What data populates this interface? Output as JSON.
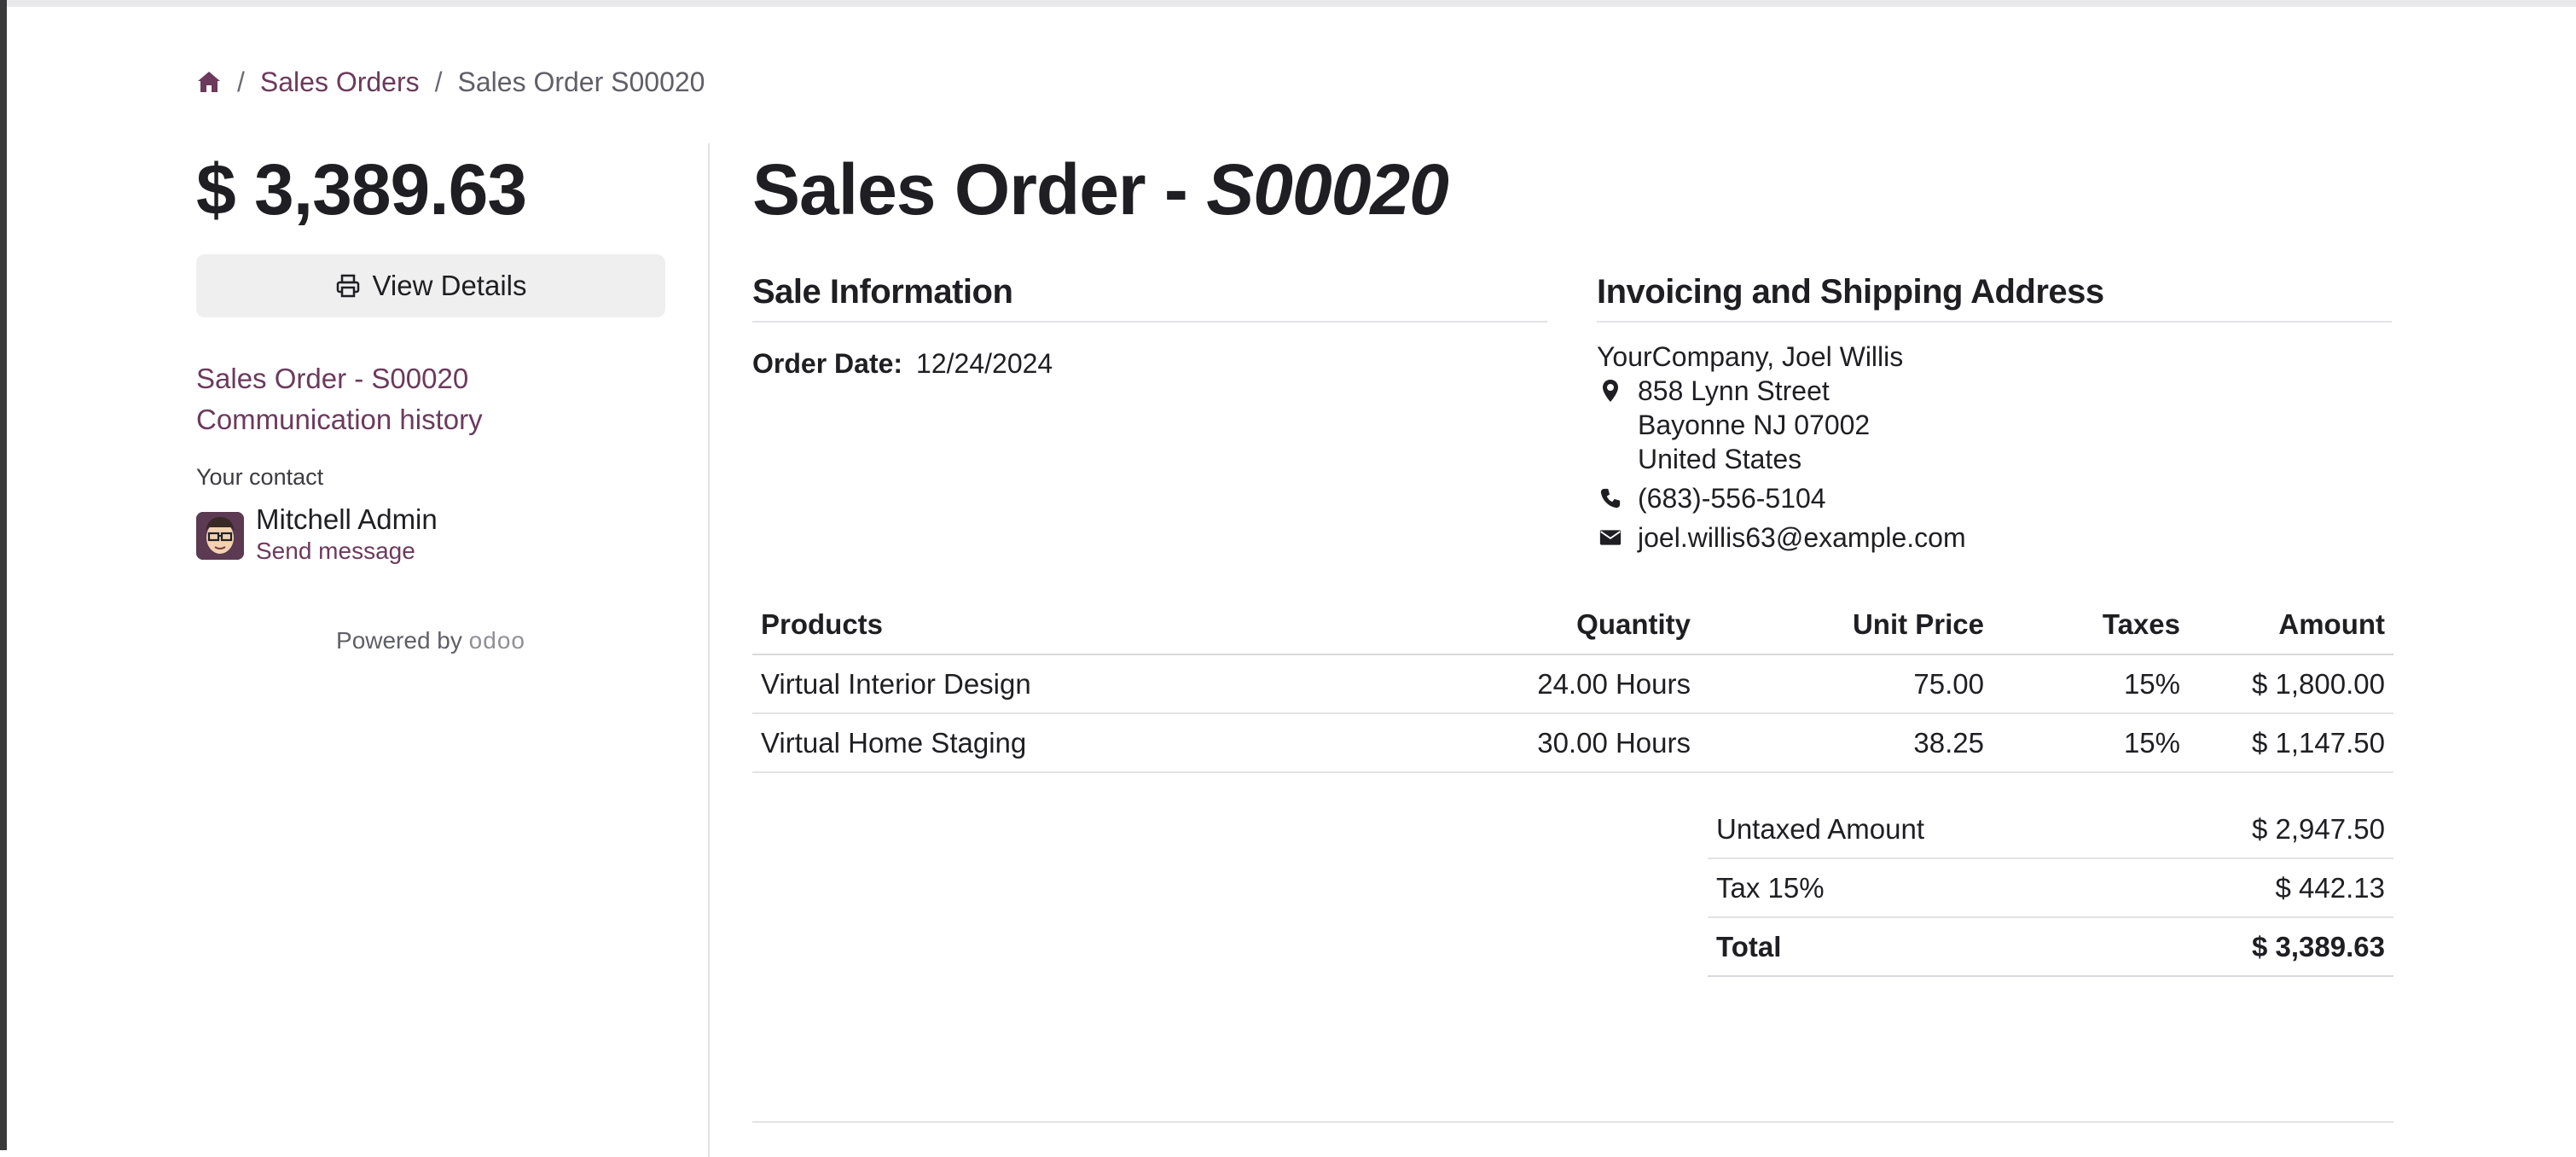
{
  "breadcrumb": {
    "home_icon": "home-icon",
    "separator": "/",
    "sales_orders": "Sales Orders",
    "current": "Sales Order S00020"
  },
  "sidebar": {
    "amount": "$ 3,389.63",
    "view_details_label": "View Details",
    "view_details_icon": "printer-icon",
    "links": [
      "Sales Order - S00020",
      "Communication history"
    ],
    "your_contact_label": "Your contact",
    "contact_name": "Mitchell Admin",
    "send_message": "Send message",
    "powered_by": "Powered by",
    "odoo_logo": "odoo"
  },
  "main": {
    "title_prefix": "Sales Order - ",
    "title_number": "S00020",
    "sale_info_heading": "Sale Information",
    "order_date_label": "Order Date:",
    "order_date_value": "12/24/2024",
    "address_heading": "Invoicing and Shipping Address",
    "address": {
      "company": "YourCompany, Joel Willis",
      "street": "858 Lynn Street",
      "city": "Bayonne NJ 07002",
      "country": "United States",
      "phone": "(683)-556-5104",
      "email": "joel.willis63@example.com"
    }
  },
  "table": {
    "headers": [
      "Products",
      "Quantity",
      "Unit Price",
      "Taxes",
      "Amount"
    ],
    "rows": [
      [
        "Virtual Interior Design",
        "24.00 Hours",
        "75.00",
        "15%",
        "$ 1,800.00"
      ],
      [
        "Virtual Home Staging",
        "30.00 Hours",
        "38.25",
        "15%",
        "$ 1,147.50"
      ]
    ]
  },
  "totals": {
    "untaxed_label": "Untaxed Amount",
    "untaxed_value": "$ 2,947.50",
    "tax_label": "Tax 15%",
    "tax_value": "$ 442.13",
    "total_label": "Total",
    "total_value": "$ 3,389.63"
  },
  "colors": {
    "link": "#6c3a5c",
    "text": "#1f1f23",
    "button_bg": "#efefef"
  }
}
